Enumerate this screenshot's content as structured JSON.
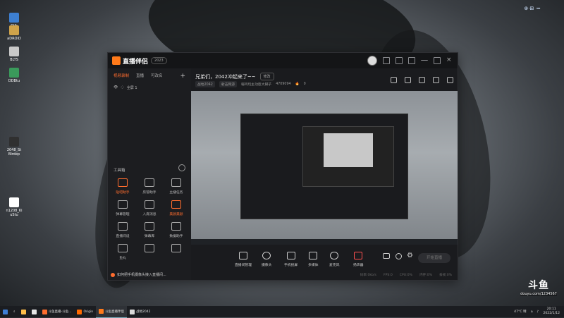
{
  "desktop": {
    "icons": [
      {
        "label": "Dllk",
        "color": "#3d7fd1"
      },
      {
        "label": "aDROID",
        "color": "#cfa34a"
      },
      {
        "label": "BLTS",
        "color": "#c9c9c9"
      },
      {
        "label": "DDBtu",
        "color": "#3a9a5b"
      },
      {
        "label": "2048_St\nBirdep",
        "color": "#303030"
      },
      {
        "label": "n1208_Ki\nuStu",
        "color": "#ffffff"
      }
    ],
    "tray_top": "⊕·⊞ ·━"
  },
  "app": {
    "name": "直播伴侣",
    "version": "2023",
    "left_tabs": [
      "视频录制",
      "直播",
      "可改名"
    ],
    "scene_name": "全屏 1",
    "tools_title": "工具箱",
    "tools": [
      {
        "label": "贴吧助手",
        "hot": true
      },
      {
        "label": "房管助手",
        "hot": false
      },
      {
        "label": "主播任务",
        "hot": false
      },
      {
        "label": "弹幕管理",
        "hot": false
      },
      {
        "label": "入席消息",
        "hot": false
      },
      {
        "label": "美颜美颜",
        "hot": true
      },
      {
        "label": "直播间设",
        "hot": false
      },
      {
        "label": "弹幕库",
        "hot": false
      },
      {
        "label": "数据助手",
        "hot": false
      },
      {
        "label": "鱼丸",
        "hot": false
      },
      {
        "label": "",
        "hot": false
      },
      {
        "label": "",
        "hot": false
      }
    ],
    "tip": "如何把手机摄像头接入直播间...",
    "room_title": "兄弟们，2042冲起来了~~",
    "edit_label": "修改",
    "room_meta": [
      "战地2042",
      "射击网游",
      "弱鸡玩主功臣大脚子",
      "4709094",
      "0"
    ],
    "controls": [
      "直播间管理",
      "摄像头",
      "手机投屏",
      "多媒体",
      "麦克风",
      "扬声器"
    ],
    "go_live": "开始直播",
    "status": [
      "码率:0kb/s",
      "FPS:0",
      "CPU:0%",
      "内存:0%",
      "丢帧:0%"
    ]
  },
  "watermark": {
    "brand": "斗鱼",
    "sub": "douyu.com/1234567"
  },
  "taskbar": {
    "tasks": [
      {
        "label": "",
        "color": "#3f7fd6"
      },
      {
        "label": "",
        "color": "#ffbf4a"
      },
      {
        "label": "",
        "color": "#e6e6e6"
      },
      {
        "label": "斗鱼直播-斗鱼...",
        "color": "#ff6d2e"
      },
      {
        "label": "Origin",
        "color": "#ff6a00"
      },
      {
        "label": "斗鱼直播伴侣",
        "color": "#ff7a1a"
      },
      {
        "label": "战地2042",
        "color": "#d9d9d9"
      }
    ],
    "tray_text": "47°C 晴",
    "time": "20:11",
    "date": "2022/1/12"
  }
}
